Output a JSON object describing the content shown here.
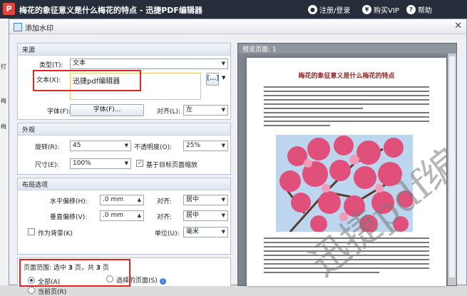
{
  "app": {
    "title": "梅花的象征意义是什么梅花的特点 - 迅捷PDF编辑器",
    "logo_letter": "P",
    "register_login": "注册/登录",
    "buy_vip": "购买VIP",
    "help": "帮助"
  },
  "background_window": {
    "menu_fragments": [
      "打",
      "梅",
      "梅"
    ]
  },
  "dialog": {
    "title": "添加水印",
    "close_glyph": "✕"
  },
  "source": {
    "section_title": "来源",
    "type_label": "类型(T):",
    "type_value": "文本",
    "text_label": "文本(X):",
    "text_value": "迅捷pdf编辑器",
    "font_label": "字体(F):",
    "font_button": "字体(F)...",
    "align_label": "对齐(L):",
    "align_value": "左"
  },
  "appearance": {
    "section_title": "外观",
    "rotation_label": "旋转(R):",
    "rotation_value": "45",
    "opacity_label": "不透明度(O):",
    "opacity_value": "25%",
    "size_label": "尺寸(E):",
    "size_value": "100%",
    "fit_label": "基于目标页面缩放",
    "fit_checked": true
  },
  "layout": {
    "section_title": "布局选项",
    "h_offset_label": "水平偏移(H):",
    "h_offset_value": ".0 mm",
    "v_offset_label": "垂直偏移(V):",
    "v_offset_value": ".0 mm",
    "h_align_label": "对齐:",
    "h_align_value": "居中",
    "v_align_label": "对齐:",
    "v_align_value": "居中",
    "background_label": "作为背景(K)",
    "background_checked": false,
    "unit_label": "单位(U):",
    "unit_value": "毫米"
  },
  "page_range": {
    "summary_prefix": "页面范围: 选中 ",
    "summary_selected": "3",
    "summary_mid": " 页，共 ",
    "summary_total": "3",
    "summary_suffix": " 页",
    "all_label": "全部(A)",
    "current_label": "当前页(R)",
    "selected_label": "选择的页面(S)",
    "selected_option": "all"
  },
  "preview": {
    "header": "预览页面: 1",
    "page_title": "梅花的象征意义是什么梅花的特点",
    "watermark_text": "迅捷pdf编辑器"
  },
  "colors": {
    "titlebar": "#262e3b",
    "highlight": "#e12424",
    "page_title": "#8b2a2a",
    "blossom": "#e0507a",
    "sky": "#bcd6ef"
  }
}
